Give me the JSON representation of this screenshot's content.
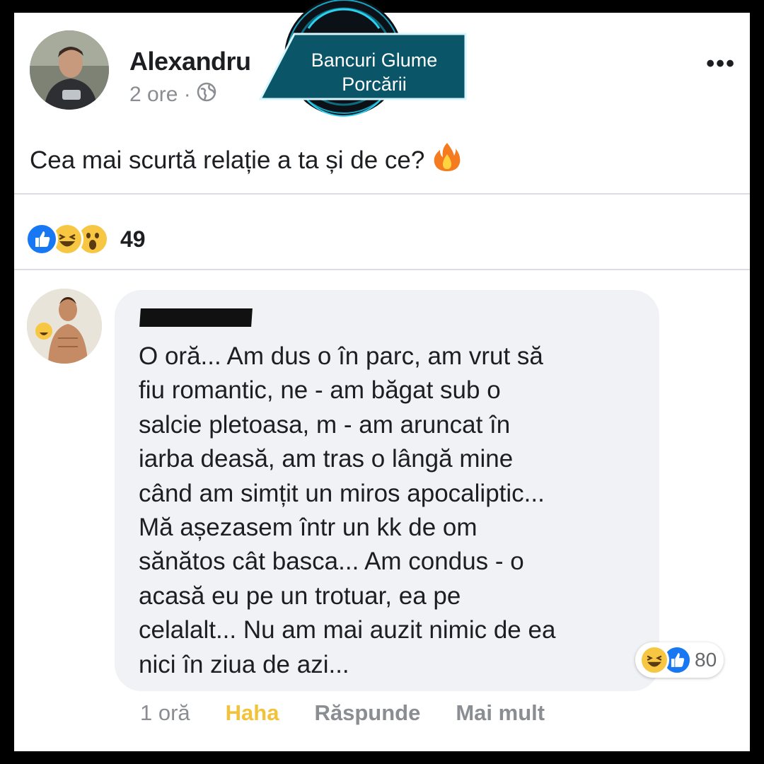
{
  "post": {
    "author": "Alexandru",
    "time": "2 ore ·",
    "privacy_icon": "globe-icon",
    "more_label": "•••",
    "text": "Cea mai scurtă relație a ta și de ce?",
    "emoji": "fire-icon",
    "reactions": [
      "like",
      "haha",
      "wow"
    ],
    "reaction_count": "49"
  },
  "comment": {
    "lines": [
      "O oră... Am dus o în parc, am vrut să",
      "fiu romantic, ne - am băgat sub o",
      "salcie pletoasa, m - am aruncat în",
      "iarba deasă, am tras o lângă mine",
      "când am simțit un miros apocaliptic...",
      "Mă așezasem într un kk de om",
      "sănătos cât basca... Am condus - o",
      "acasă eu pe un trotuar, ea pe",
      "celalalt... Nu am mai auzit nimic de ea",
      "nici în ziua de azi..."
    ],
    "reactions": [
      "haha",
      "like"
    ],
    "reaction_count": "80",
    "time": "1 oră",
    "haha_label": "Haha",
    "reply_label": "Răspunde",
    "more_label": "Mai mult"
  },
  "watermark": {
    "line1": "Bancuri Glume",
    "line2": "Porcării"
  },
  "colors": {
    "like_blue": "#1877f2",
    "haha_yellow": "#f7c744",
    "watermark_teal": "#0a5668",
    "bubble_gray": "#f0f2f5"
  }
}
